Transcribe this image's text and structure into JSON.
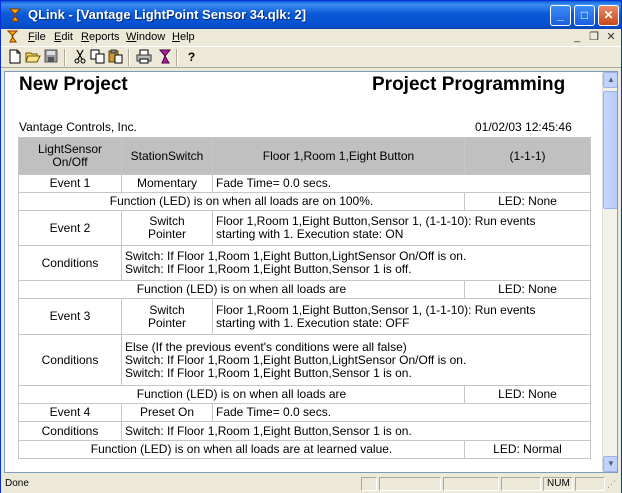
{
  "window": {
    "title": "QLink - [Vantage LightPoint Sensor 34.qlk: 2]",
    "controls": {
      "minimize": "_",
      "maximize": "□",
      "close": "✕"
    }
  },
  "menu": {
    "items": [
      {
        "accel": "F",
        "rest": "ile"
      },
      {
        "accel": "E",
        "rest": "dit"
      },
      {
        "accel": "R",
        "rest": "eports"
      },
      {
        "accel": "W",
        "rest": "indow"
      },
      {
        "accel": "H",
        "rest": "elp"
      }
    ],
    "mdi_controls": {
      "minimize": "_",
      "restore": "❐",
      "close": "✕"
    }
  },
  "toolbar": {
    "icons": [
      "new-icon",
      "open-icon",
      "save-icon",
      "cut-icon",
      "copy-icon",
      "paste-icon",
      "print-icon",
      "program-icon",
      "help-icon"
    ]
  },
  "document": {
    "project_name": "New Project",
    "report_title": "Project Programming",
    "company": "Vantage Controls, Inc.",
    "datetime": "01/02/03 12:45:46",
    "header": {
      "col1_line1": "LightSensor",
      "col1_line2": "On/Off",
      "col2": "StationSwitch",
      "col3": "Floor 1,Room 1,Eight Button",
      "col4": "(1-1-1)"
    },
    "rows": {
      "event1_label": "Event 1",
      "event1_type": "Momentary",
      "event1_desc": "Fade Time= 0.0 secs.",
      "func1": "Function (LED) is on when all loads are on 100%.",
      "led1": "LED: None",
      "event2_label": "Event 2",
      "event2_type_l1": "Switch",
      "event2_type_l2": "Pointer",
      "event2_desc_l1": "Floor 1,Room 1,Eight Button,Sensor 1, (1-1-10): Run events",
      "event2_desc_l2": "starting with 1. Execution state: ON",
      "cond2_label": "Conditions",
      "cond2_l1": "Switch: If Floor 1,Room 1,Eight Button,LightSensor On/Off is on.",
      "cond2_l2": "Switch: If Floor 1,Room 1,Eight Button,Sensor 1 is off.",
      "func2": "Function (LED) is on when all loads are",
      "led2": "LED: None",
      "event3_label": "Event 3",
      "event3_type_l1": "Switch",
      "event3_type_l2": "Pointer",
      "event3_desc_l1": "Floor 1,Room 1,Eight Button,Sensor 1, (1-1-10): Run events",
      "event3_desc_l2": "starting with 1. Execution state: OFF",
      "cond3_label": "Conditions",
      "cond3_l1": "Else (If the previous event's conditions were all false)",
      "cond3_l2": "Switch: If Floor 1,Room 1,Eight Button,LightSensor On/Off is on.",
      "cond3_l3": "Switch: If Floor 1,Room 1,Eight Button,Sensor 1 is on.",
      "func3": "Function (LED) is on when all loads are",
      "led3": "LED: None",
      "event4_label": "Event 4",
      "event4_type": "Preset On",
      "event4_desc": "Fade Time= 0.0 secs.",
      "cond4_label": "Conditions",
      "cond4_l1": "Switch: If Floor 1,Room 1,Eight Button,Sensor 1 is on.",
      "func4": "Function (LED) is on when all loads are at learned value.",
      "led4": "LED: Normal"
    }
  },
  "statusbar": {
    "text": "Done",
    "num": "NUM"
  }
}
